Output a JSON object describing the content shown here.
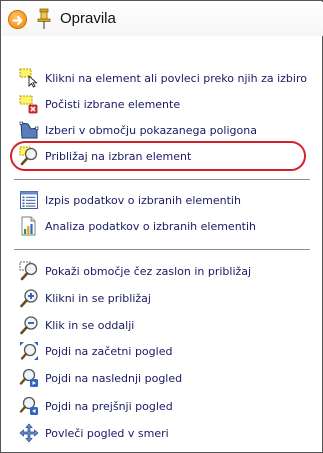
{
  "panel": {
    "title": "Opravila",
    "icons": {
      "arrow": "orange-circle-arrow-icon",
      "pin": "pin-icon"
    }
  },
  "groups": [
    {
      "items": [
        {
          "label": "Klikni na element ali povleci preko njih za izbiro",
          "icon": "select-by-click-icon"
        },
        {
          "label": "Počisti izbrane elemente",
          "icon": "clear-selection-icon"
        },
        {
          "label": "Izberi v območju pokazanega poligona",
          "icon": "select-by-polygon-icon"
        },
        {
          "label": "Približaj na izbran element",
          "icon": "zoom-to-selected-icon",
          "highlighted": true
        }
      ]
    },
    {
      "items": [
        {
          "label": "Izpis podatkov o izbranih elementih",
          "icon": "list-report-icon"
        },
        {
          "label": "Analiza podatkov o izbranih elementih",
          "icon": "chart-analysis-icon"
        }
      ]
    },
    {
      "items": [
        {
          "label": "Pokaži območje čez zaslon in približaj",
          "icon": "zoom-area-icon"
        },
        {
          "label": "Klikni in se približaj",
          "icon": "zoom-in-icon"
        },
        {
          "label": "Klik in se oddalji",
          "icon": "zoom-out-icon"
        },
        {
          "label": "Pojdi na začetni pogled",
          "icon": "zoom-full-extent-icon"
        },
        {
          "label": "Pojdi na naslednji pogled",
          "icon": "next-view-icon"
        },
        {
          "label": "Pojdi na prejšnji pogled",
          "icon": "previous-view-icon"
        },
        {
          "label": "Povleči pogled v smeri",
          "icon": "pan-icon"
        }
      ]
    }
  ],
  "colors": {
    "text": "#1a1a66",
    "highlight": "#d8202a",
    "separator": "#8a8a9a"
  }
}
